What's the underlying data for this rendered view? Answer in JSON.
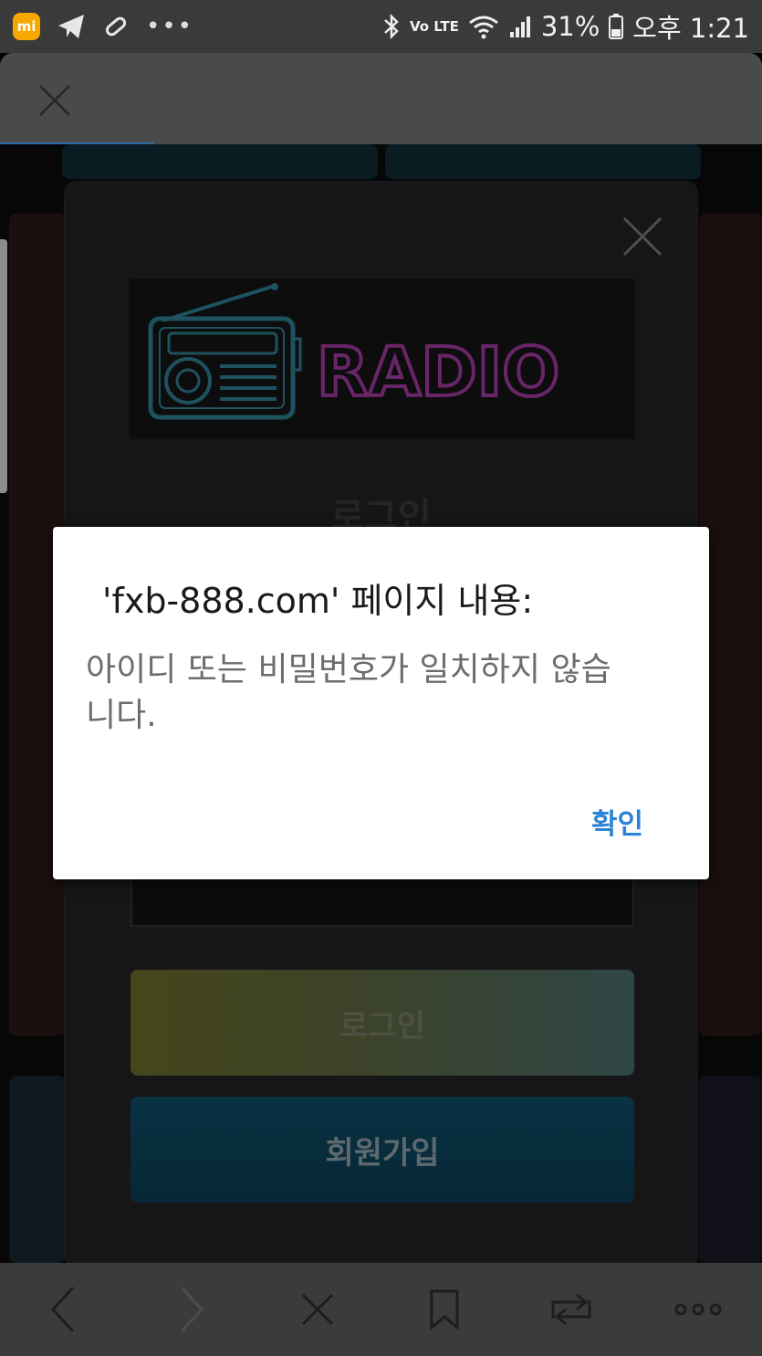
{
  "status_bar": {
    "battery_percent": "31%",
    "time": "오후 1:21",
    "network_label": "Vo LTE",
    "icons": [
      "mi-icon",
      "telegram-icon",
      "pill-icon",
      "more-dots-icon",
      "bluetooth-icon",
      "lte-icon",
      "wifi-icon",
      "signal-icon",
      "battery-icon"
    ]
  },
  "browser": {
    "close_icon": "close-icon"
  },
  "login_modal": {
    "logo_text": "RADIO",
    "heading": "로그인",
    "login_button": "로그인",
    "signup_button": "회원가입"
  },
  "alert": {
    "title": "'fxb-888.com' 페이지 내용:",
    "message": "아이디 또는 비밀번호가 일치하지 않습니다.",
    "ok_label": "확인",
    "ok_color": "#2c83d4"
  },
  "bottom_nav": {
    "icons": [
      "back-icon",
      "forward-icon",
      "close-tab-icon",
      "bookmark-icon",
      "tabs-icon",
      "more-icon"
    ]
  }
}
